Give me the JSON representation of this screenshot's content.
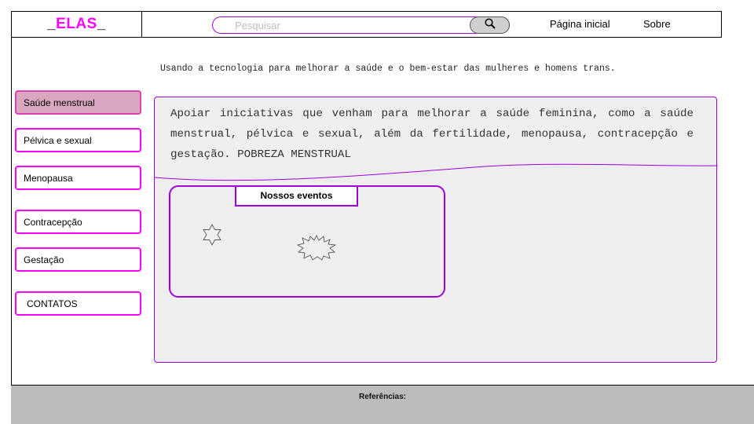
{
  "header": {
    "logo": {
      "prefix": "_",
      "name": "ELAS",
      "suffix": "_"
    },
    "search": {
      "placeholder": "Pesquisar",
      "value": ""
    },
    "nav": {
      "home": "Página inicial",
      "about": "Sobre"
    }
  },
  "tagline": "Usando a tecnologia para melhorar a saúde e o bem-estar das mulheres e homens trans.",
  "sidebar": {
    "items": [
      {
        "label": "Saúde menstrual",
        "active": true
      },
      {
        "label": "Pélvica e sexual",
        "active": false
      },
      {
        "label": "Menopausa",
        "active": false
      },
      {
        "label": "Contracepção",
        "active": false
      },
      {
        "label": "Gestação",
        "active": false
      },
      {
        "label": "CONTATOS",
        "active": false
      }
    ]
  },
  "main": {
    "intro": "Apoiar iniciativas que venham para melhorar a saúde feminina, como a saúde menstrual, pélvica e sexual, além da fertilidade, menopausa, contracepção e gestação. POBREZA MENSTRUAL",
    "events": {
      "title": "Nossos eventos"
    }
  },
  "footer": {
    "title": "Referências:"
  },
  "colors": {
    "logo": "#ff00ff",
    "sidebar_border": "#ff00ff",
    "active_item": "#d9a8c0",
    "accent": "#a000e0",
    "footer": "#bcbcbc"
  },
  "icons": {
    "search": "magnifier-icon",
    "event_star_1": "six-point-star-icon",
    "event_star_2": "burst-star-icon"
  }
}
